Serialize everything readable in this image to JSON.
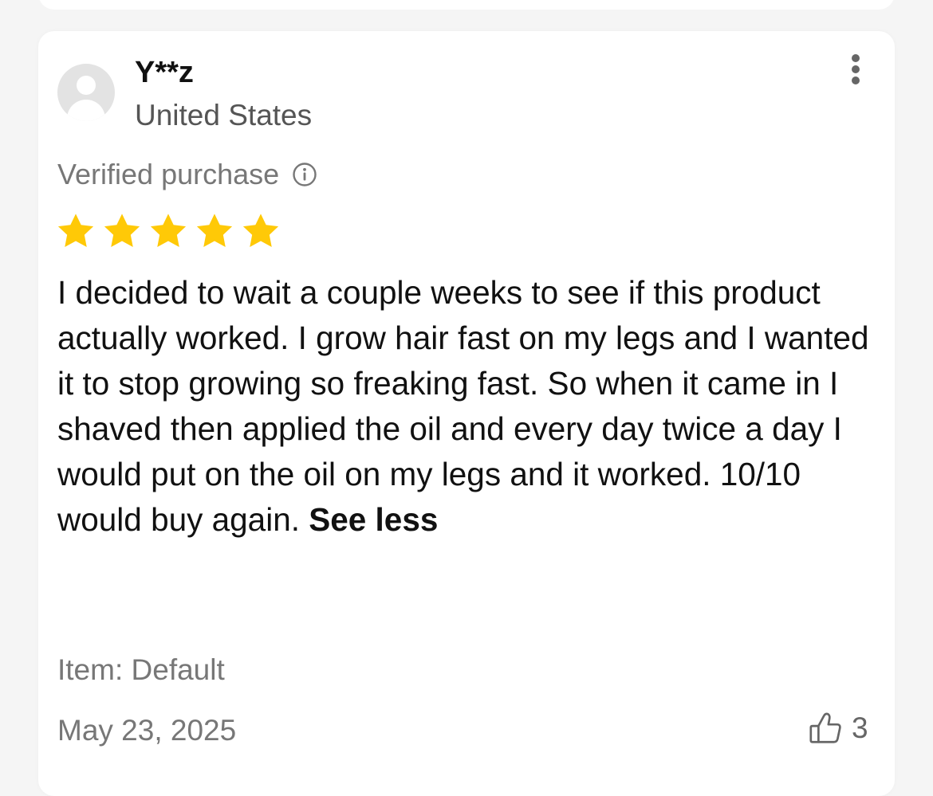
{
  "review": {
    "username": "Y**z",
    "country": "United States",
    "verified_label": "Verified purchase",
    "rating": 5,
    "rating_max": 5,
    "text": "I decided to wait a couple weeks to see if this product actually worked. I grow hair fast on my legs and I wanted it to stop growing so freaking fast. So when it came in I shaved then applied the oil and every day twice a day I would put on the oil on my legs and it worked. 10/10 would buy again.",
    "see_less_label": "See less",
    "item": "Item: Default",
    "date": "May 23, 2025",
    "helpful_count": "3"
  },
  "icons": {
    "more": "more-vertical-icon",
    "info": "info-icon",
    "star": "star-icon",
    "thumbs_up": "thumbs-up-icon"
  },
  "colors": {
    "star": "#FFC907",
    "background": "#f5f5f5",
    "card": "#ffffff",
    "muted_text": "#777777"
  }
}
